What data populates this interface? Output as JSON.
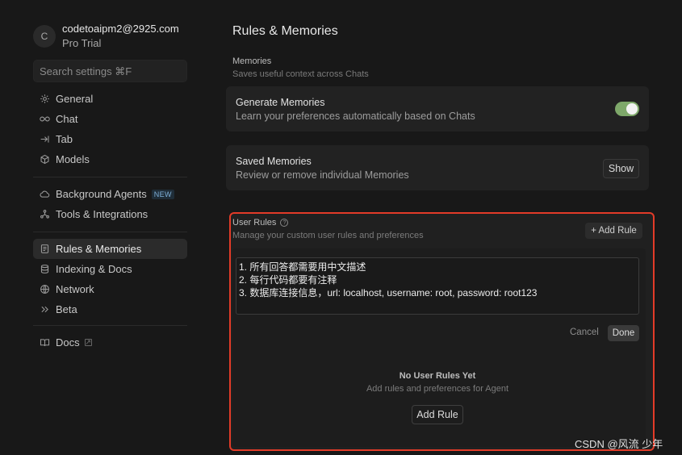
{
  "profile": {
    "avatar_initial": "C",
    "email": "codetoaipm2@2925.com",
    "plan": "Pro Trial"
  },
  "search": {
    "placeholder": "Search settings ⌘F"
  },
  "sidebar": {
    "group1": [
      {
        "label": "General",
        "icon": "gear-icon"
      },
      {
        "label": "Chat",
        "icon": "infinity-icon"
      },
      {
        "label": "Tab",
        "icon": "tab-arrow-icon"
      },
      {
        "label": "Models",
        "icon": "cube-icon"
      }
    ],
    "group2": [
      {
        "label": "Background Agents",
        "icon": "cloud-icon",
        "badge": "NEW"
      },
      {
        "label": "Tools & Integrations",
        "icon": "nodes-icon"
      }
    ],
    "group3": [
      {
        "label": "Rules & Memories",
        "icon": "document-icon",
        "active": true
      },
      {
        "label": "Indexing & Docs",
        "icon": "database-icon"
      },
      {
        "label": "Network",
        "icon": "globe-icon"
      },
      {
        "label": "Beta",
        "icon": "chevrons-icon"
      }
    ],
    "group4": [
      {
        "label": "Docs",
        "icon": "book-icon"
      }
    ]
  },
  "main": {
    "title": "Rules & Memories",
    "memories": {
      "heading": "Memories",
      "description": "Saves useful context across Chats",
      "generate": {
        "title": "Generate Memories",
        "description": "Learn your preferences automatically based on Chats",
        "enabled": true
      },
      "saved": {
        "title": "Saved Memories",
        "description": "Review or remove individual Memories",
        "button": "Show"
      }
    },
    "user_rules": {
      "heading": "User Rules",
      "description": "Manage your custom user rules and preferences",
      "add_button": "+ Add Rule",
      "editor_lines": [
        "1. 所有回答都需要用中文描述",
        "2. 每行代码都要有注释",
        "3. 数据库连接信息，url: localhost, username: root, password: root123"
      ],
      "cancel": "Cancel",
      "done": "Done",
      "empty_title": "No User Rules Yet",
      "empty_description": "Add rules and preferences for Agent",
      "empty_button": "Add Rule"
    }
  },
  "watermark": "CSDN @风流 少年",
  "colors": {
    "background": "#181818",
    "card": "#222222",
    "toggle_on": "#7ea86a",
    "highlight_border": "#e23b28"
  }
}
